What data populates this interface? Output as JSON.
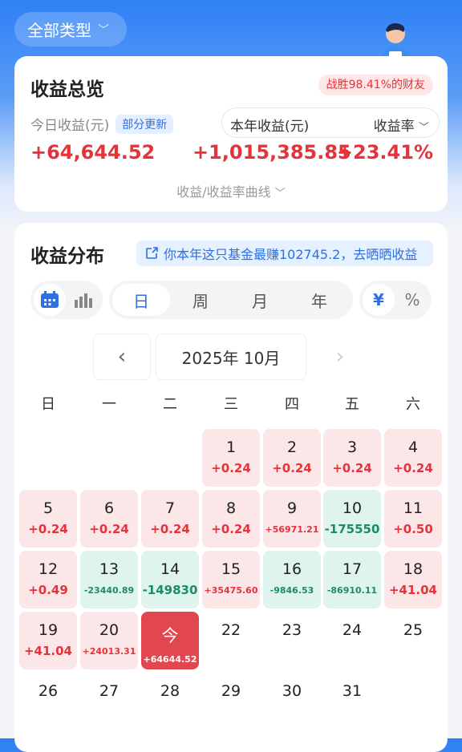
{
  "header": {
    "filter_label": "全部类型"
  },
  "overview": {
    "title": "收益总览",
    "rank_badge": "战胜98.41%的财友",
    "today_label": "今日收益(元)",
    "partial_update": "部分更新",
    "year_label": "本年收益(元)",
    "rate_label": "收益率",
    "today_value": "+64,644.52",
    "year_value": "+1,015,385.85",
    "rate_value": "+23.41%",
    "curve_link": "收益/收益率曲线"
  },
  "distribution": {
    "title": "收益分布",
    "share_text": "你本年这只基金最赚102745.2，去晒晒收益",
    "periods": [
      "日",
      "周",
      "月",
      "年"
    ],
    "units": [
      "¥",
      "%"
    ],
    "month_label": "2025年 10月",
    "weekdays": [
      "日",
      "一",
      "二",
      "三",
      "四",
      "五",
      "六"
    ]
  },
  "days": [
    {
      "n": "1",
      "v": "+0.24",
      "t": "pos"
    },
    {
      "n": "2",
      "v": "+0.24",
      "t": "pos"
    },
    {
      "n": "3",
      "v": "+0.24",
      "t": "pos"
    },
    {
      "n": "4",
      "v": "+0.24",
      "t": "pos"
    },
    {
      "n": "5",
      "v": "+0.24",
      "t": "pos"
    },
    {
      "n": "6",
      "v": "+0.24",
      "t": "pos"
    },
    {
      "n": "7",
      "v": "+0.24",
      "t": "pos"
    },
    {
      "n": "8",
      "v": "+0.24",
      "t": "pos"
    },
    {
      "n": "9",
      "v": "+56971.21",
      "t": "pos"
    },
    {
      "n": "10",
      "v": "-175550",
      "t": "neg"
    },
    {
      "n": "11",
      "v": "+0.50",
      "t": "pos"
    },
    {
      "n": "12",
      "v": "+0.49",
      "t": "pos"
    },
    {
      "n": "13",
      "v": "-23440.89",
      "t": "neg"
    },
    {
      "n": "14",
      "v": "-149830",
      "t": "neg"
    },
    {
      "n": "15",
      "v": "+35475.60",
      "t": "pos"
    },
    {
      "n": "16",
      "v": "-9846.53",
      "t": "neg"
    },
    {
      "n": "17",
      "v": "-86910.11",
      "t": "neg"
    },
    {
      "n": "18",
      "v": "+41.04",
      "t": "pos"
    },
    {
      "n": "19",
      "v": "+41.04",
      "t": "pos"
    },
    {
      "n": "20",
      "v": "+24013.31",
      "t": "pos"
    },
    {
      "n": "今",
      "v": "+64644.52",
      "t": "today"
    },
    {
      "n": "22",
      "v": "",
      "t": "none"
    },
    {
      "n": "23",
      "v": "",
      "t": "none"
    },
    {
      "n": "24",
      "v": "",
      "t": "none"
    },
    {
      "n": "25",
      "v": "",
      "t": "none"
    },
    {
      "n": "26",
      "v": "",
      "t": "none"
    },
    {
      "n": "27",
      "v": "",
      "t": "none"
    },
    {
      "n": "28",
      "v": "",
      "t": "none"
    },
    {
      "n": "29",
      "v": "",
      "t": "none"
    },
    {
      "n": "30",
      "v": "",
      "t": "none"
    },
    {
      "n": "31",
      "v": "",
      "t": "none"
    }
  ],
  "colors": {
    "accent": "#2f6fe0",
    "positive": "#e5333b",
    "negative": "#1d8c66"
  }
}
